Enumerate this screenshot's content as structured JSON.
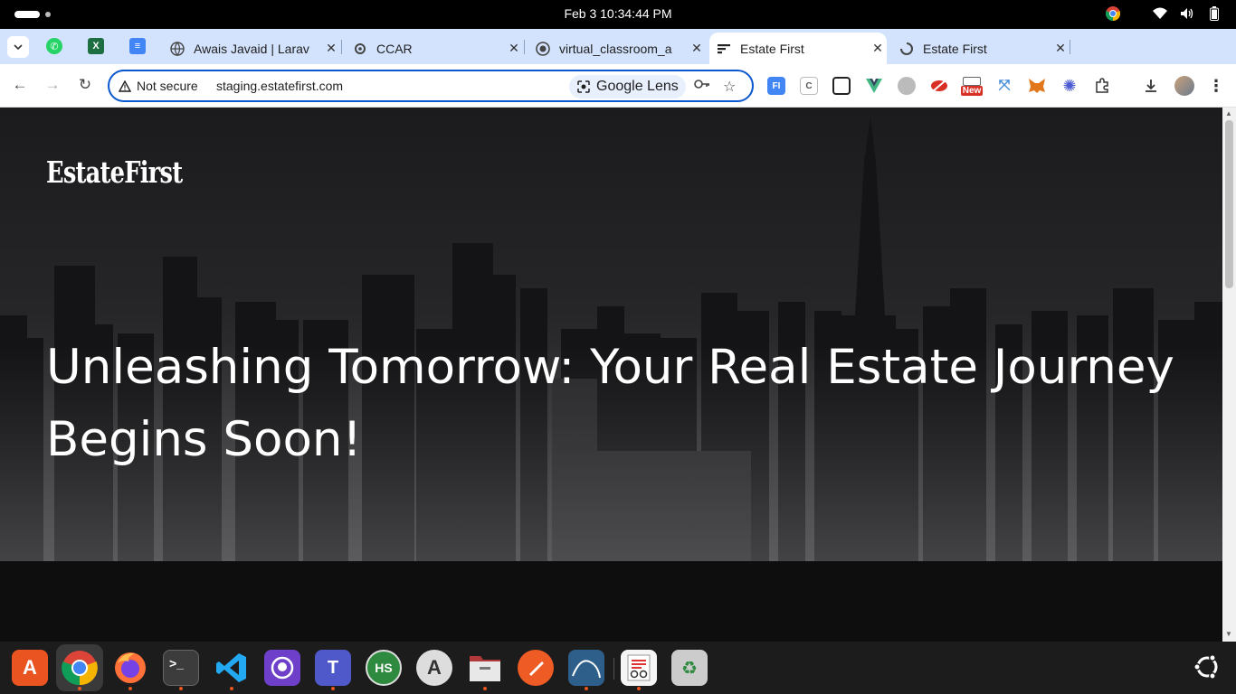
{
  "system_bar": {
    "clock": "Feb 3  10:34:44 PM"
  },
  "tabs": [
    {
      "title": "Awais Javaid | Larav",
      "favicon": "globe-icon"
    },
    {
      "title": "CCAR",
      "favicon": "chat-icon"
    },
    {
      "title": "virtual_classroom_a",
      "favicon": "github-icon"
    },
    {
      "title": "Estate First",
      "favicon": "estatefirst-icon",
      "active": true
    },
    {
      "title": "Estate First",
      "favicon": "loading-icon"
    }
  ],
  "omnibox": {
    "security_label": "Not secure",
    "url": "staging.estatefirst.com",
    "lens_label": "Google Lens"
  },
  "extensions": {
    "new_badge": "New"
  },
  "page": {
    "logo": "EstateFirst",
    "headline": "Unleashing Tomorrow: Your Real Estate Journey Begins Soon!"
  },
  "dock": {
    "apps": [
      "App Center",
      "Google Chrome",
      "Firefox",
      "Terminal",
      "Visual Studio Code",
      "GitHub Desktop",
      "Teams for Linux",
      "HS",
      "Software Updater",
      "Files",
      "Postman",
      "MySQL Workbench",
      "Document Viewer",
      "Trash"
    ],
    "hs_label": "HS"
  },
  "colors": {
    "tabstrip_bg": "#d3e3fd",
    "omnibox_border": "#0b57d0",
    "ubuntu_orange": "#e95420"
  }
}
